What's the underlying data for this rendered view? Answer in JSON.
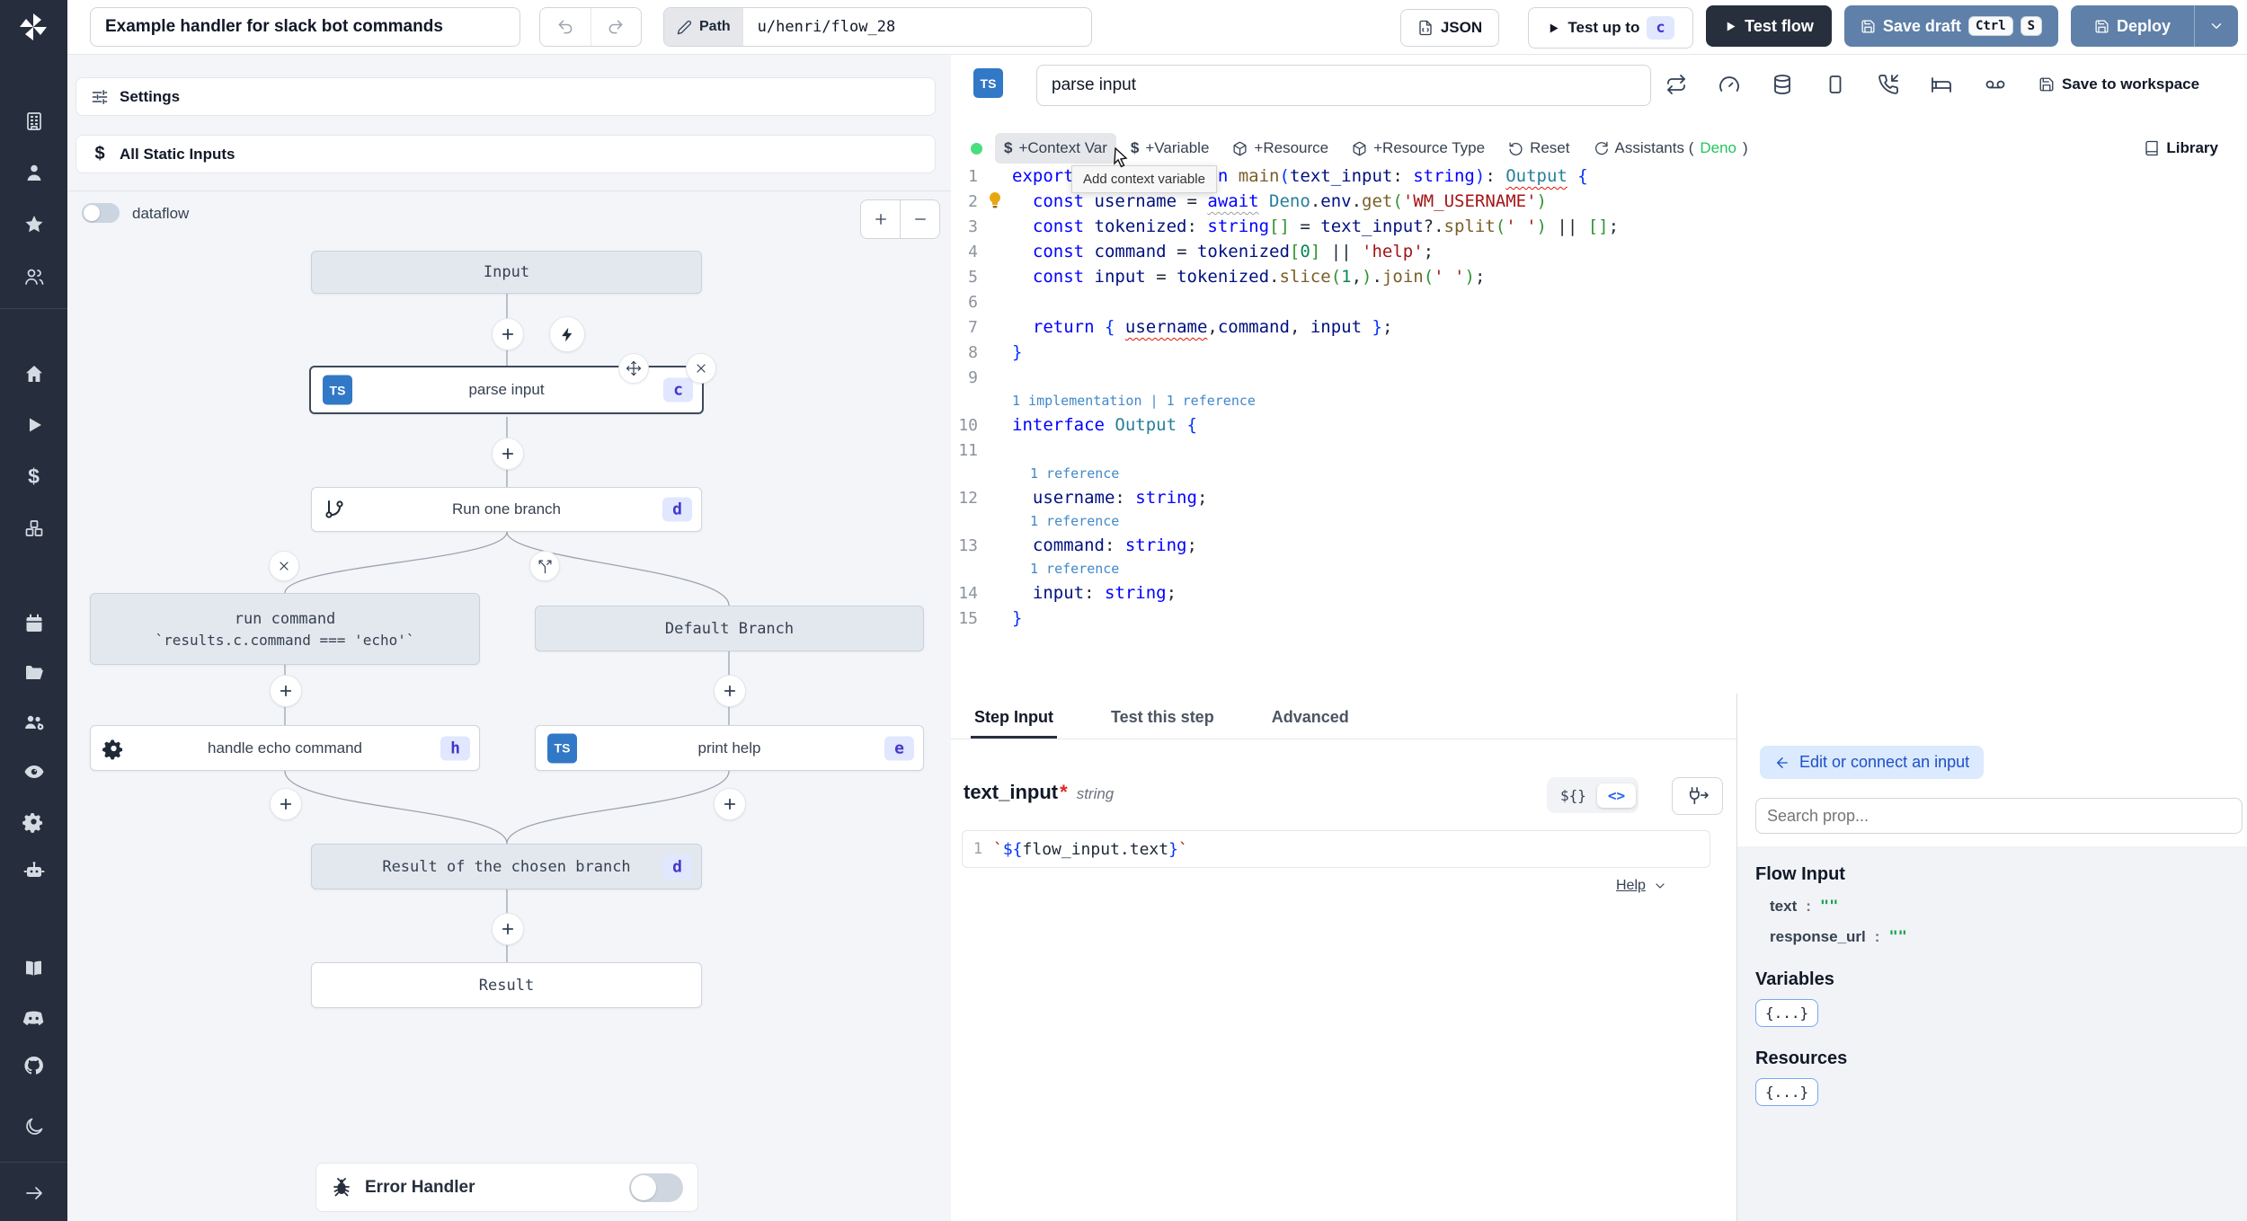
{
  "colors": {
    "button_blue": "#5f80a8",
    "dark_navy": "#262e3d",
    "badge_bg": "#e0e7ff",
    "badge_text": "#4338ca",
    "ts_blue": "#3178c6",
    "green_dot": "#4ade80",
    "deno_green": "#22c55e"
  },
  "glyphs": {
    "ts": "TS",
    "dollar": "$",
    "braces": "${}",
    "code_tag": "<>",
    "object_chip": "{...}"
  },
  "topbar": {
    "title": "Example handler for slack bot commands",
    "path_label": "Path",
    "path_value": "u/henri/flow_28",
    "json_button": "JSON",
    "test_up_to": "Test up to",
    "test_up_to_badge": "c",
    "test_flow": "Test flow",
    "save_draft": "Save draft",
    "kbd_ctrl": "Ctrl",
    "kbd_s": "S",
    "deploy": "Deploy"
  },
  "flow_panel": {
    "settings": "Settings",
    "all_static_inputs": "All Static Inputs",
    "dataflow": "dataflow",
    "nodes": {
      "input": "Input",
      "parse_input": {
        "label": "parse input",
        "badge": "c"
      },
      "run_one_branch": {
        "label": "Run one branch",
        "badge": "d"
      },
      "run_command": {
        "line1": "run command",
        "line2": "`results.c.command === 'echo'`"
      },
      "default_branch": "Default Branch",
      "handle_echo": {
        "label": "handle echo command",
        "badge": "h"
      },
      "print_help": {
        "label": "print help",
        "badge": "e"
      },
      "result_branch": {
        "label": "Result of the chosen branch",
        "badge": "d"
      },
      "result": "Result",
      "error_handler": "Error Handler"
    }
  },
  "editor": {
    "step_name": "parse input",
    "save_to_workspace": "Save to workspace",
    "tooltip": "Add context variable",
    "toolbar": {
      "context_var": "+Context Var",
      "variable": "+Variable",
      "resource": "+Resource",
      "resource_type": "+Resource Type",
      "reset": "Reset",
      "assistants_prefix": "Assistants (",
      "assistants_lang": "Deno",
      "assistants_suffix": ")",
      "library": "Library"
    },
    "code": {
      "lines": [
        {
          "num": "1",
          "tokens": [
            {
              "t": "export",
              "c": "kw"
            },
            {
              "t": " ",
              "c": "pl"
            },
            {
              "t": "async",
              "c": "kw"
            },
            {
              "t": " ",
              "c": "pl"
            },
            {
              "t": "function",
              "c": "kw"
            },
            {
              "t": " ",
              "c": "pl"
            },
            {
              "t": "main",
              "c": "fn"
            },
            {
              "t": "(",
              "c": "p1"
            },
            {
              "t": "text_input",
              "c": "var"
            },
            {
              "t": ": ",
              "c": "pl"
            },
            {
              "t": "string",
              "c": "kw"
            },
            {
              "t": ")",
              "c": "p1"
            },
            {
              "t": ": ",
              "c": "pl"
            },
            {
              "t": "Output",
              "c": "type",
              "u": "err"
            },
            {
              "t": " ",
              "c": "pl"
            },
            {
              "t": "{",
              "c": "p1"
            }
          ]
        },
        {
          "num": "2",
          "bulb": true,
          "tokens": [
            {
              "t": "  ",
              "c": "pl"
            },
            {
              "t": "const",
              "c": "kw"
            },
            {
              "t": " ",
              "c": "pl"
            },
            {
              "t": "username",
              "c": "var"
            },
            {
              "t": " = ",
              "c": "pl"
            },
            {
              "t": "await",
              "c": "kw",
              "u": "info"
            },
            {
              "t": " ",
              "c": "pl"
            },
            {
              "t": "Deno",
              "c": "type"
            },
            {
              "t": ".",
              "c": "pl"
            },
            {
              "t": "env",
              "c": "var"
            },
            {
              "t": ".",
              "c": "pl"
            },
            {
              "t": "get",
              "c": "fn"
            },
            {
              "t": "(",
              "c": "p2"
            },
            {
              "t": "'WM_USERNAME'",
              "c": "str"
            },
            {
              "t": ")",
              "c": "p2"
            }
          ]
        },
        {
          "num": "3",
          "tokens": [
            {
              "t": "  ",
              "c": "pl"
            },
            {
              "t": "const",
              "c": "kw"
            },
            {
              "t": " ",
              "c": "pl"
            },
            {
              "t": "tokenized",
              "c": "var"
            },
            {
              "t": ": ",
              "c": "pl"
            },
            {
              "t": "string",
              "c": "kw"
            },
            {
              "t": "[]",
              "c": "p2"
            },
            {
              "t": " = ",
              "c": "pl"
            },
            {
              "t": "text_input",
              "c": "var"
            },
            {
              "t": "?.",
              "c": "pl"
            },
            {
              "t": "split",
              "c": "fn"
            },
            {
              "t": "(",
              "c": "p2"
            },
            {
              "t": "' '",
              "c": "str"
            },
            {
              "t": ")",
              "c": "p2"
            },
            {
              "t": " || ",
              "c": "pl"
            },
            {
              "t": "[]",
              "c": "p2"
            },
            {
              "t": ";",
              "c": "pl"
            }
          ]
        },
        {
          "num": "4",
          "tokens": [
            {
              "t": "  ",
              "c": "pl"
            },
            {
              "t": "const",
              "c": "kw"
            },
            {
              "t": " ",
              "c": "pl"
            },
            {
              "t": "command",
              "c": "var"
            },
            {
              "t": " = ",
              "c": "pl"
            },
            {
              "t": "tokenized",
              "c": "var"
            },
            {
              "t": "[",
              "c": "p2"
            },
            {
              "t": "0",
              "c": "num"
            },
            {
              "t": "]",
              "c": "p2"
            },
            {
              "t": " || ",
              "c": "pl"
            },
            {
              "t": "'help'",
              "c": "str"
            },
            {
              "t": ";",
              "c": "pl"
            }
          ]
        },
        {
          "num": "5",
          "tokens": [
            {
              "t": "  ",
              "c": "pl"
            },
            {
              "t": "const",
              "c": "kw"
            },
            {
              "t": " ",
              "c": "pl"
            },
            {
              "t": "input",
              "c": "var"
            },
            {
              "t": " = ",
              "c": "pl"
            },
            {
              "t": "tokenized",
              "c": "var"
            },
            {
              "t": ".",
              "c": "pl"
            },
            {
              "t": "slice",
              "c": "fn"
            },
            {
              "t": "(",
              "c": "p2"
            },
            {
              "t": "1",
              "c": "num"
            },
            {
              "t": ",",
              "c": "pl"
            },
            {
              "t": ")",
              "c": "p2"
            },
            {
              "t": ".",
              "c": "pl"
            },
            {
              "t": "join",
              "c": "fn"
            },
            {
              "t": "(",
              "c": "p2"
            },
            {
              "t": "' '",
              "c": "str"
            },
            {
              "t": ")",
              "c": "p2"
            },
            {
              "t": ";",
              "c": "pl"
            }
          ]
        },
        {
          "num": "6",
          "tokens": []
        },
        {
          "num": "7",
          "tokens": [
            {
              "t": "  ",
              "c": "pl"
            },
            {
              "t": "return",
              "c": "kw"
            },
            {
              "t": " ",
              "c": "pl"
            },
            {
              "t": "{",
              "c": "p1"
            },
            {
              "t": " ",
              "c": "pl"
            },
            {
              "t": "username",
              "c": "var",
              "u": "err"
            },
            {
              "t": ",",
              "c": "pl"
            },
            {
              "t": "command",
              "c": "var"
            },
            {
              "t": ", ",
              "c": "pl"
            },
            {
              "t": "input",
              "c": "var"
            },
            {
              "t": " ",
              "c": "pl"
            },
            {
              "t": "}",
              "c": "p1"
            },
            {
              "t": ";",
              "c": "pl"
            }
          ]
        },
        {
          "num": "8",
          "tokens": [
            {
              "t": "}",
              "c": "p1"
            }
          ]
        },
        {
          "num": "9",
          "tokens": []
        },
        {
          "lens": "1 implementation | 1 reference"
        },
        {
          "num": "10",
          "tokens": [
            {
              "t": "interface",
              "c": "kw"
            },
            {
              "t": " ",
              "c": "pl"
            },
            {
              "t": "Output",
              "c": "type"
            },
            {
              "t": " ",
              "c": "pl"
            },
            {
              "t": "{",
              "c": "p1"
            }
          ]
        },
        {
          "num": "11",
          "tokens": []
        },
        {
          "lens": "1 reference",
          "indent": true
        },
        {
          "num": "12",
          "tokens": [
            {
              "t": "  ",
              "c": "pl"
            },
            {
              "t": "username",
              "c": "var"
            },
            {
              "t": ": ",
              "c": "pl"
            },
            {
              "t": "string",
              "c": "kw"
            },
            {
              "t": ";",
              "c": "pl"
            }
          ]
        },
        {
          "lens": "1 reference",
          "indent": true
        },
        {
          "num": "13",
          "tokens": [
            {
              "t": "  ",
              "c": "pl"
            },
            {
              "t": "command",
              "c": "var"
            },
            {
              "t": ": ",
              "c": "pl"
            },
            {
              "t": "string",
              "c": "kw"
            },
            {
              "t": ";",
              "c": "pl"
            }
          ]
        },
        {
          "lens": "1 reference",
          "indent": true
        },
        {
          "num": "14",
          "tokens": [
            {
              "t": "  ",
              "c": "pl"
            },
            {
              "t": "input",
              "c": "var"
            },
            {
              "t": ": ",
              "c": "pl"
            },
            {
              "t": "string",
              "c": "kw"
            },
            {
              "t": ";",
              "c": "pl"
            }
          ]
        },
        {
          "num": "15",
          "tokens": [
            {
              "t": "}",
              "c": "p1"
            }
          ]
        }
      ]
    }
  },
  "step_panel": {
    "tabs": [
      "Step Input",
      "Test this step",
      "Advanced"
    ],
    "field": {
      "name": "text_input",
      "required": "*",
      "type": "string"
    },
    "expr_line_num": "1",
    "expr_tokens": [
      {
        "t": "`",
        "c": "str"
      },
      {
        "t": "${",
        "c": "p1"
      },
      {
        "t": "flow_input.text",
        "c": "pl"
      },
      {
        "t": "}",
        "c": "p1"
      },
      {
        "t": "`",
        "c": "str"
      }
    ],
    "help": "Help"
  },
  "inspector": {
    "edit_connect": "Edit or connect an input",
    "search_placeholder": "Search prop...",
    "flow_input": "Flow Input",
    "props": [
      {
        "name": "text",
        "colon": ":",
        "value": "\"\""
      },
      {
        "name": "response_url",
        "colon": ":",
        "value": "\"\""
      }
    ],
    "variables": "Variables",
    "resources": "Resources"
  }
}
